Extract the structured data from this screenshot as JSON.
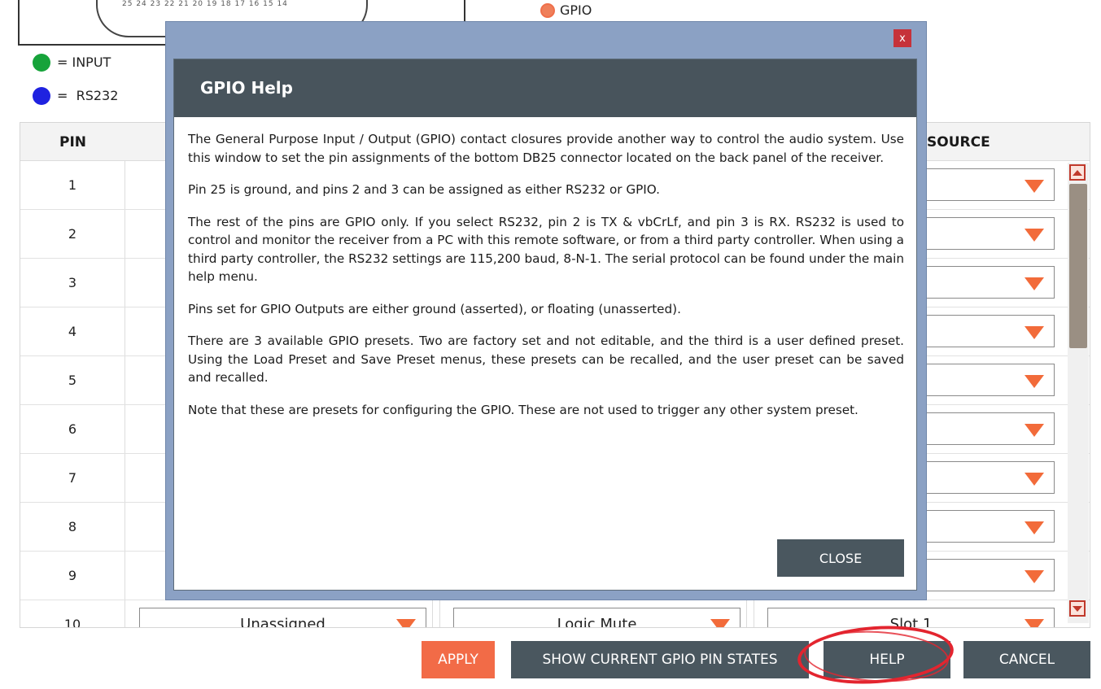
{
  "background": {
    "connector_pin_numbers": "25 24 23 22 21 20 19 18 17 16 15 14",
    "gpio_radio_label": "GPIO",
    "legend": [
      {
        "color": "#16a33a",
        "label": "= INPUT"
      },
      {
        "color": "#1f22e0",
        "label": "=  RS232"
      }
    ],
    "grid": {
      "pin_header": "PIN",
      "source_header": "SOURCE",
      "pins": [
        "1",
        "2",
        "3",
        "4",
        "5",
        "6",
        "7",
        "8",
        "9",
        "10"
      ],
      "row10": {
        "assignment": "Unassigned",
        "function": "Logic Mute",
        "source": "Slot 1"
      }
    },
    "buttons": {
      "apply": "APPLY",
      "show_states": "SHOW CURRENT GPIO PIN STATES",
      "help": "HELP",
      "cancel": "CANCEL"
    }
  },
  "modal": {
    "close_x": "x",
    "title": "GPIO Help",
    "paragraphs": [
      "The General Purpose Input / Output (GPIO) contact closures provide another way to control the audio system.  Use this window to set the pin assignments of the bottom DB25 connector located on the back panel of the receiver.",
      "Pin 25 is ground, and pins 2 and 3 can be assigned as either RS232 or GPIO.",
      "The rest of the pins are GPIO only. If you select RS232, pin 2 is TX & vbCrLf, and pin 3 is RX. RS232 is used to control and monitor the receiver from a PC with this remote software, or from a third party controller. When using a third party controller, the RS232 settings are 115,200 baud, 8-N-1. The serial protocol can be found under the main help menu.",
      "Pins set for GPIO Outputs are either ground (asserted), or floating (unasserted).",
      "There are 3 available GPIO presets. Two are factory set and not editable, and the third is a user defined preset. Using the Load Preset and Save Preset menus, these presets can be recalled, and the user preset can be saved and recalled.",
      "Note that these are presets for configuring the GPIO. These are not used to trigger any other system preset."
    ],
    "close_button": "CLOSE"
  },
  "colors": {
    "accent_orange": "#f26b3a",
    "button_dark": "#4a575f",
    "title_bar": "#48545c",
    "modal_frame": "#8ba1c4",
    "annotation_red": "#e3252f"
  }
}
